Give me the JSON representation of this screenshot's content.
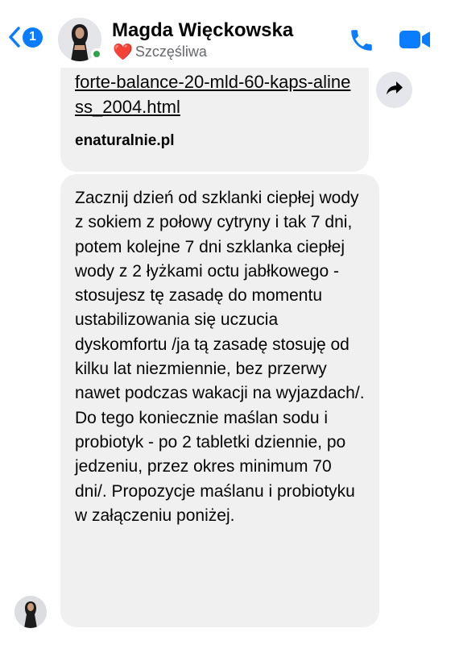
{
  "header": {
    "back_count": "1",
    "contact_name": "Magda Więckowska",
    "status_text": "Szczęśliwa",
    "status_emoji": "❤️",
    "online": true,
    "accent_color": "#0a7cff"
  },
  "messages": {
    "link_preview": {
      "url_text": "forte-balance-20-mld-60-kaps-aliness_2004.html",
      "domain": "enaturalnie.pl"
    },
    "text_message": "Zacznij dzień od szklanki ciepłej wody z sokiem z połowy cytryny i tak 7 dni, potem kolejne 7 dni szklanka ciepłej wody z 2 łyżkami octu jabłkowego - stosujesz tę zasadę do momentu ustabilizowania się uczucia dyskomfortu /ja tą zasadę stosuję od kilku lat niezmiennie, bez przerwy nawet podczas wakacji na wyjazdach/. Do tego koniecznie maślan sodu i probiotyk - po 2 tabletki dziennie, po jedzeniu, przez okres minimum 70 dni/. Propozycje maślanu i probiotyku w załączeniu poniżej."
  },
  "icons": {
    "back": "chevron-left-icon",
    "call": "phone-icon",
    "video": "video-camera-icon",
    "share": "forward-arrow-icon"
  }
}
